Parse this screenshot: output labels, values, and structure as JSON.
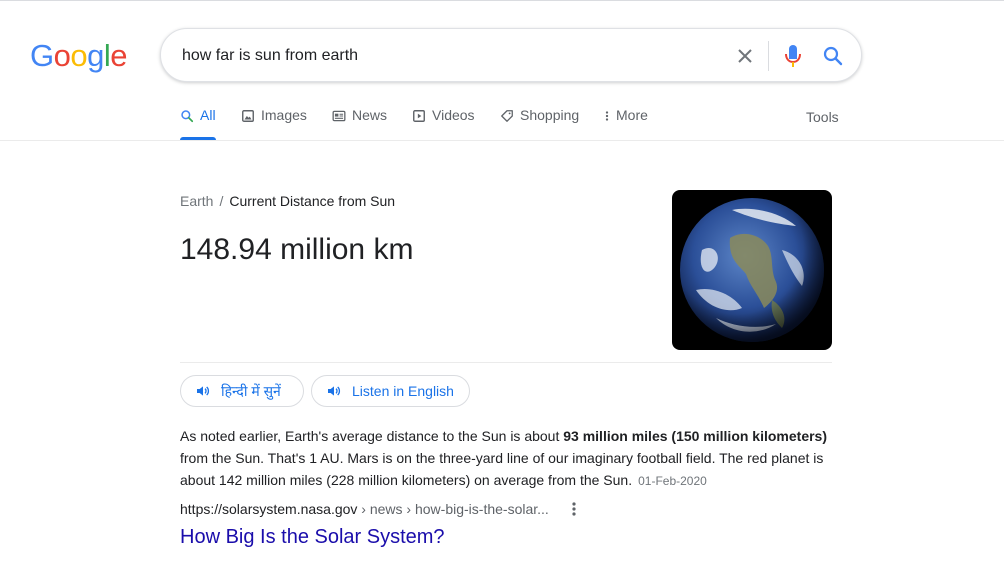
{
  "logo": {
    "letters": [
      "G",
      "o",
      "o",
      "g",
      "l",
      "e"
    ]
  },
  "search": {
    "query": "how far is sun from earth"
  },
  "tabs": [
    {
      "label": "All",
      "icon": "search-icon",
      "active": true
    },
    {
      "label": "Images",
      "icon": "image-icon"
    },
    {
      "label": "News",
      "icon": "news-icon"
    },
    {
      "label": "Videos",
      "icon": "video-icon"
    },
    {
      "label": "Shopping",
      "icon": "tag-icon"
    },
    {
      "label": "More",
      "icon": "more-vert-icon"
    }
  ],
  "tools_label": "Tools",
  "answer": {
    "breadcrumb_parent": "Earth",
    "breadcrumb_sep": "/",
    "breadcrumb_current": "Current Distance from Sun",
    "value": "148.94 million km"
  },
  "listen": {
    "hindi_label": "हिन्दी में सुनें",
    "english_label": "Listen in English"
  },
  "snippet": {
    "part1": "As noted earlier, Earth's average distance to the Sun is about ",
    "bold": "93 million miles (150 million kilometers)",
    "part2": " from the Sun. That's 1 AU. Mars is on the three-yard line of our imaginary football field. The red planet is about 142 million miles (228 million kilometers) on average from the Sun.",
    "date": "01-Feb-2020"
  },
  "result": {
    "url_base": "https://solarsystem.nasa.gov",
    "url_path": " › news › how-big-is-the-solar...",
    "title": "How Big Is the Solar System?"
  },
  "colors": {
    "link_blue": "#1a73e8",
    "visited_title": "#1a0dab",
    "google_blue": "#4285f4",
    "google_red": "#ea4335",
    "google_yellow": "#fbbc05",
    "google_green": "#34a853"
  }
}
